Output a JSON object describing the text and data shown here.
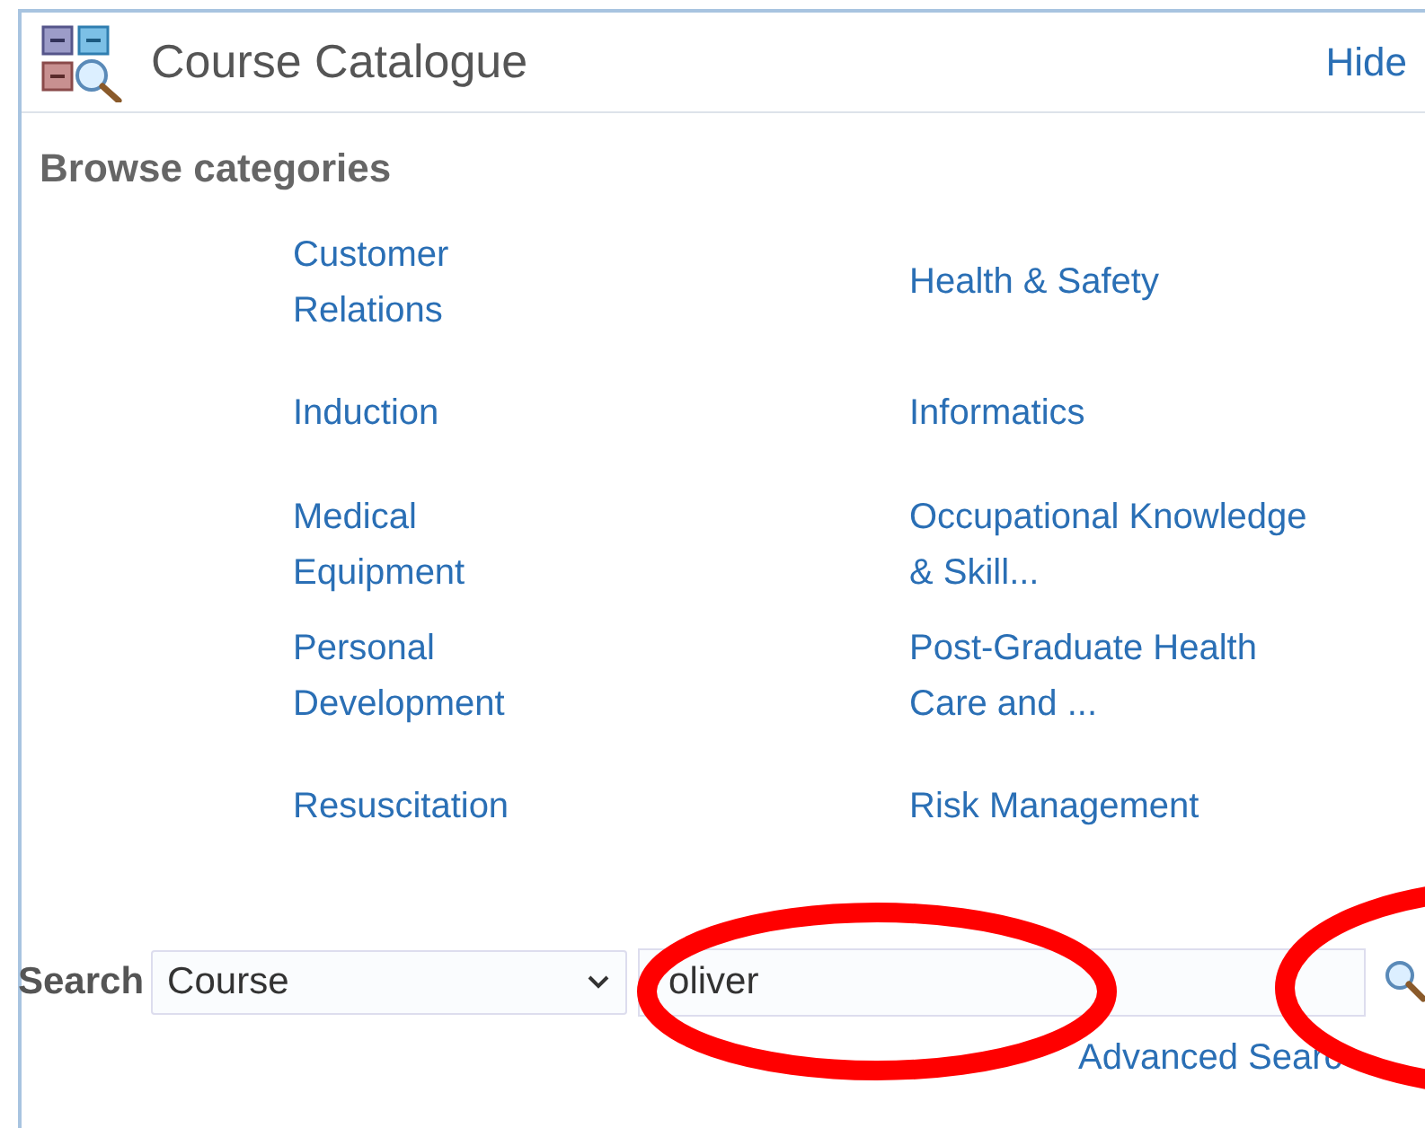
{
  "panel": {
    "title": "Course Catalogue",
    "hide_link": "Hide"
  },
  "browse": {
    "heading": "Browse categories",
    "categories": [
      {
        "label": "Customer Relations"
      },
      {
        "label": "Health & Safety"
      },
      {
        "label": "Induction"
      },
      {
        "label": "Informatics"
      },
      {
        "label": "Medical Equipment"
      },
      {
        "label": "Occupational Knowledge & Skill..."
      },
      {
        "label": "Personal Development"
      },
      {
        "label": "Post-Graduate Health Care and ..."
      },
      {
        "label": "Resuscitation"
      },
      {
        "label": "Risk Management"
      }
    ]
  },
  "search": {
    "label": "Search",
    "scope": "Course",
    "value": "oliver",
    "advanced_link": "Advanced Searc"
  }
}
